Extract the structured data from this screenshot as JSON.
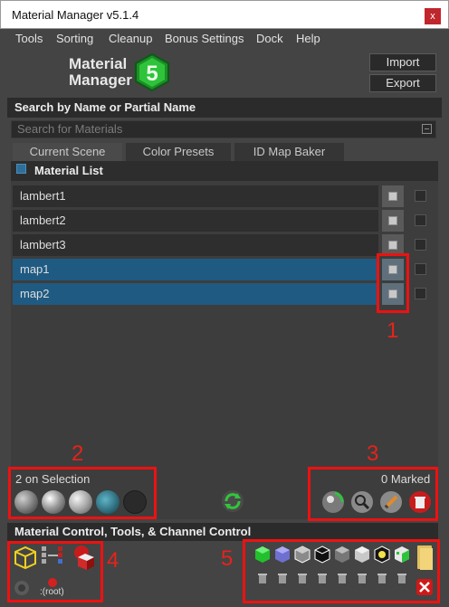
{
  "window": {
    "title": "Material Manager v5.1.4",
    "close": "x"
  },
  "menu": [
    "Tools",
    "Sorting",
    "Cleanup",
    "Bonus Settings",
    "Dock",
    "Help"
  ],
  "logo": {
    "line1": "Material",
    "line2": "Manager",
    "version_glyph": "5"
  },
  "buttons": {
    "import": "Import",
    "export": "Export"
  },
  "search": {
    "header": "Search by Name or Partial Name",
    "placeholder": "Search for Materials"
  },
  "tabs": [
    "Current Scene",
    "Color Presets",
    "ID Map Baker"
  ],
  "material_list": {
    "header": "Material List",
    "items": [
      {
        "name": "lambert1",
        "selected": false
      },
      {
        "name": "lambert2",
        "selected": false
      },
      {
        "name": "lambert3",
        "selected": false
      },
      {
        "name": "map1",
        "selected": true
      },
      {
        "name": "map2",
        "selected": true
      }
    ]
  },
  "status": {
    "selection": "2 on Selection",
    "marked": "0 Marked"
  },
  "material_control": {
    "header": "Material Control, Tools, & Channel Control",
    "root_label": ":(root)"
  },
  "annotations": [
    "1",
    "2",
    "3",
    "4",
    "5"
  ],
  "colors": {
    "selection": "#1f5a82",
    "annotation_red": "#ee1111",
    "accent_green": "#22c02c"
  }
}
